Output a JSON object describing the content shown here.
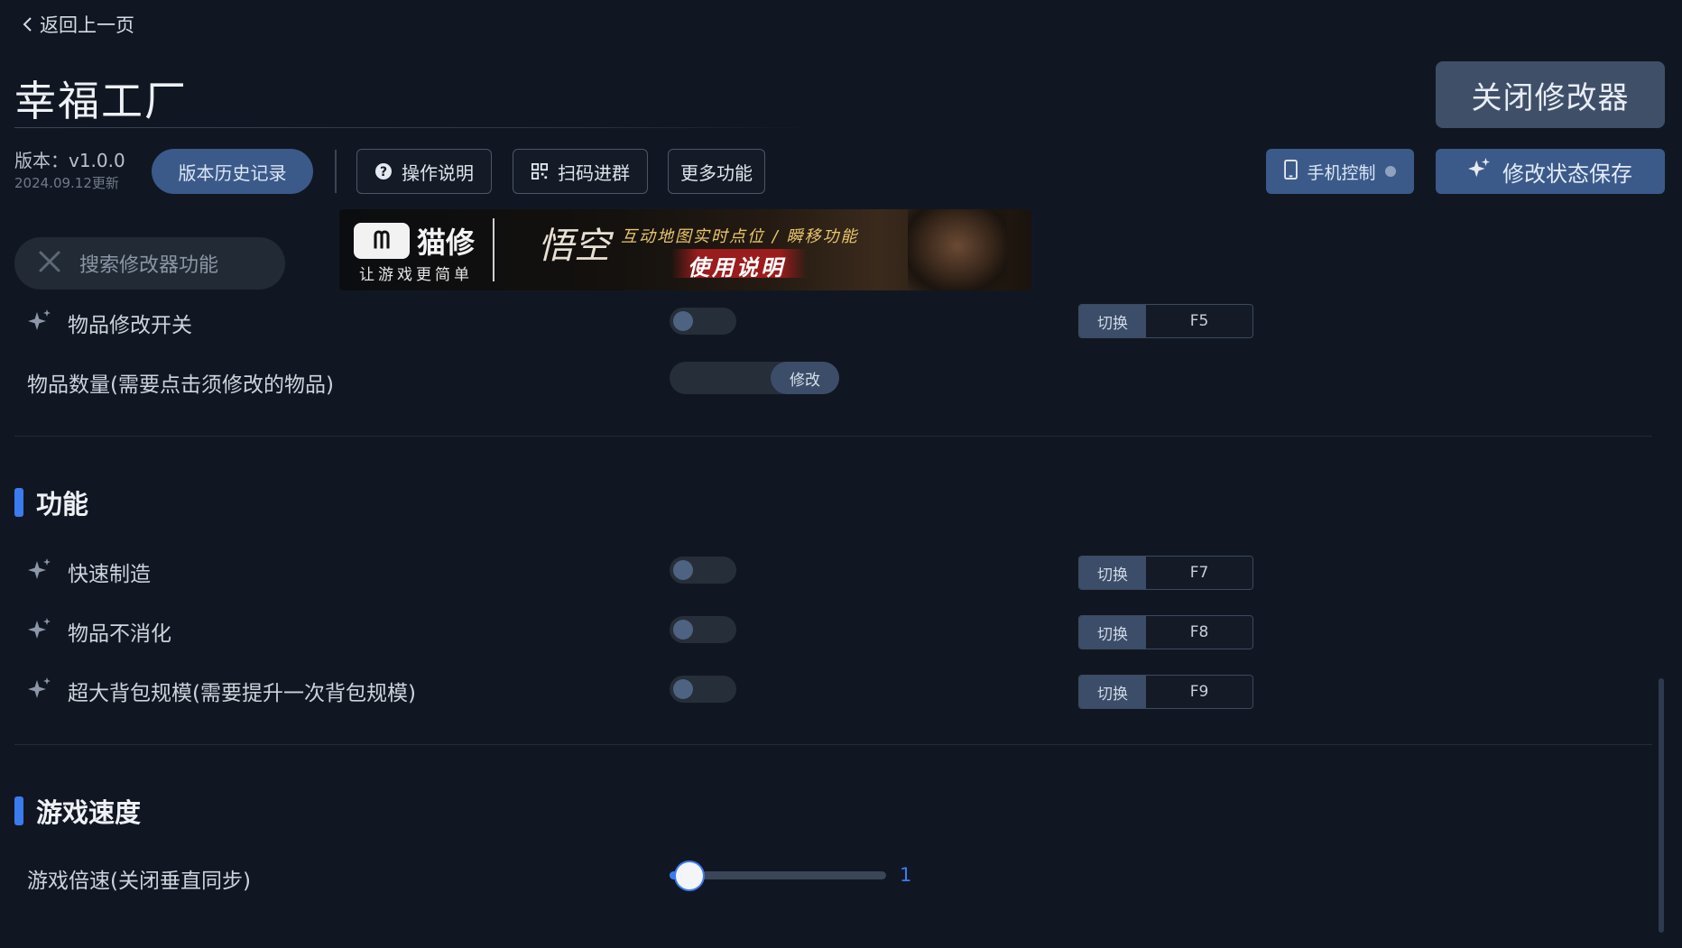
{
  "header": {
    "back_label": "返回上一页",
    "title": "幸福工厂",
    "close_label": "关闭修改器"
  },
  "toolbar": {
    "version_text": "版本：v1.0.0",
    "version_date": "2024.09.12更新",
    "history_label": "版本历史记录",
    "manual_label": "操作说明",
    "qr_label": "扫码进群",
    "more_label": "更多功能",
    "phone_label": "手机控制",
    "save_label": "修改状态保存"
  },
  "search": {
    "placeholder": "搜索修改器功能"
  },
  "banner": {
    "brand": "猫修",
    "slogan": "让游戏更简单",
    "line1": "互动地图实时点位 / 瞬移功能",
    "line2": "使用说明"
  },
  "items_top": {
    "item_toggle": {
      "label": "物品修改开关",
      "hk_label": "切换",
      "key": "F5"
    },
    "item_amount": {
      "label": "物品数量(需要点击须修改的物品)",
      "action": "修改"
    }
  },
  "sections": {
    "features": {
      "title": "功能",
      "rows": [
        {
          "label": "快速制造",
          "hk_label": "切换",
          "key": "F7"
        },
        {
          "label": "物品不消化",
          "hk_label": "切换",
          "key": "F8"
        },
        {
          "label": "超大背包规模(需要提升一次背包规模)",
          "hk_label": "切换",
          "key": "F9"
        }
      ]
    },
    "speed": {
      "title": "游戏速度",
      "slider_label": "游戏倍速(关闭垂直同步)",
      "value": "1",
      "fill_fraction": 0.09
    }
  },
  "colors": {
    "background": "#111722",
    "accent": "#3b7bf0",
    "button": "#3b5a89"
  }
}
